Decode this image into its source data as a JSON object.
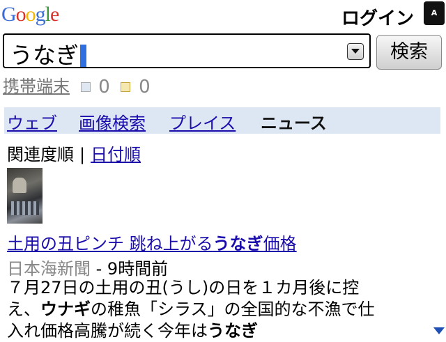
{
  "header": {
    "logo": [
      "G",
      "o",
      "o",
      "g",
      "l",
      "e"
    ],
    "logo_colors": [
      "#3b6cd4",
      "#d9342b",
      "#f2b705",
      "#3b6cd4",
      "#3a9a3a",
      "#d9342b"
    ],
    "login_label": "ログイン",
    "corner_label": "A"
  },
  "search": {
    "query": "うなぎ",
    "button_label": "検索"
  },
  "mobile": {
    "label": "携帯端末",
    "contacts_count": "0",
    "mail_count": "0"
  },
  "tabs": {
    "web": "ウェブ",
    "images": "画像検索",
    "places": "プレイス",
    "news": "ニュース"
  },
  "sort": {
    "relevance": "関連度順",
    "separator": "|",
    "date": "日付順"
  },
  "result": {
    "headline_part1": "土用の丑ピンチ 跳ね上がる",
    "headline_bold": "うなぎ",
    "headline_part2": "価格",
    "source": "日本海新聞",
    "time": " - 9時間前",
    "snippet_line1": "７月27日の土用の丑(うし)の日を１カ月後に控",
    "snippet_line2_a": "え、",
    "snippet_line2_bold": "ウナギ",
    "snippet_line2_b": "の稚魚「シラス」の全国的な不漁で仕",
    "snippet_line3_a": "入れ価格高騰が続く今年は",
    "snippet_line3_bold": "うなぎ"
  }
}
